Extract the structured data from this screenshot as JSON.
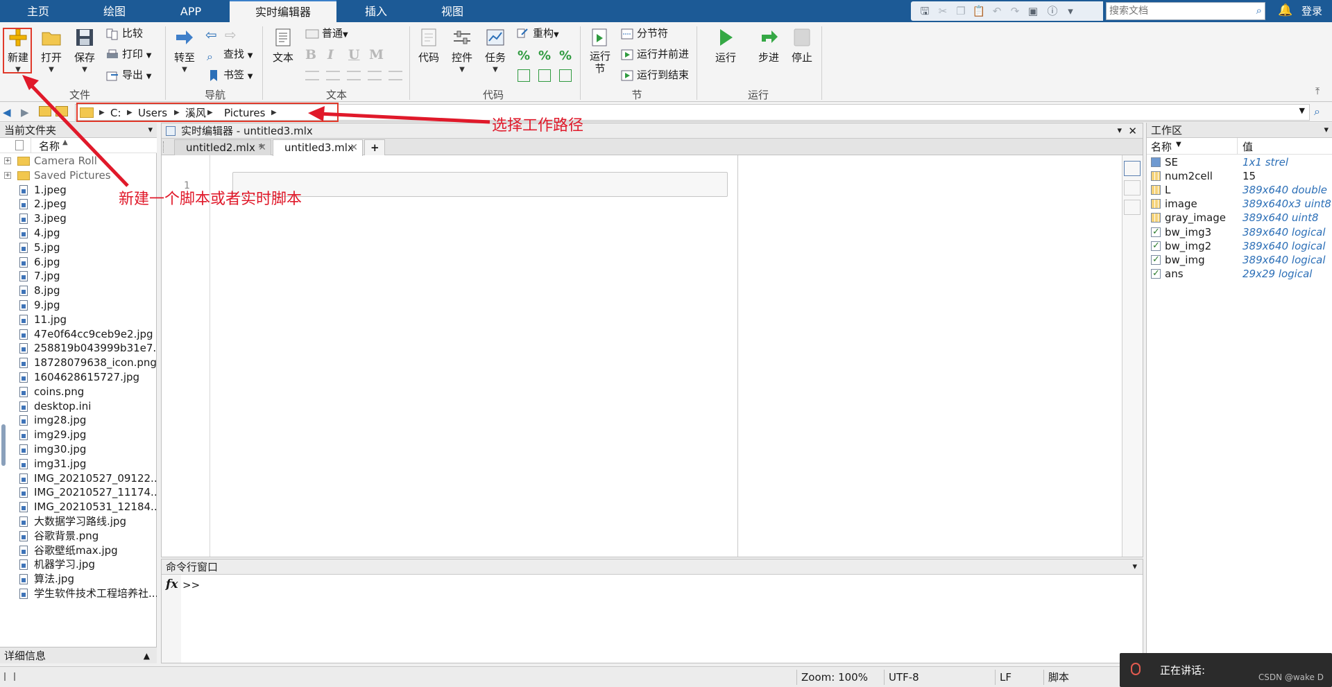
{
  "tabs": [
    "主页",
    "绘图",
    "APP",
    "实时编辑器",
    "插入",
    "视图"
  ],
  "active_tab": "实时编辑器",
  "search": {
    "placeholder": "搜索文档"
  },
  "login": "登录",
  "ribbon": {
    "file": {
      "new": "新建",
      "open": "打开",
      "save": "保存",
      "compare": "比较",
      "print": "打印",
      "export": "导出",
      "group": "文件"
    },
    "nav": {
      "goto": "转至",
      "find": "查找",
      "bookmark": "书签",
      "group": "导航"
    },
    "text": {
      "text": "文本",
      "style": "普通",
      "group": "文本",
      "bold": "B",
      "italic": "I",
      "underline": "U",
      "mono": "M"
    },
    "code": {
      "code": "代码",
      "control": "控件",
      "task": "任务",
      "refactor": "重构",
      "group": "代码"
    },
    "section": {
      "run_section": "运行\n节",
      "section_break": "分节符",
      "run_advance": "运行并前进",
      "run_to_end": "运行到结束",
      "group": "节"
    },
    "run": {
      "run": "运行",
      "step": "步进",
      "stop": "停止",
      "group": "运行"
    }
  },
  "path": [
    "C:",
    "Users",
    "溪风",
    "Pictures"
  ],
  "current_folder": {
    "title": "当前文件夹",
    "column": "名称",
    "items": [
      {
        "name": "Camera Roll",
        "type": "folder"
      },
      {
        "name": "Saved Pictures",
        "type": "folder"
      },
      {
        "name": "1.jpeg",
        "type": "file"
      },
      {
        "name": "2.jpeg",
        "type": "file"
      },
      {
        "name": "3.jpeg",
        "type": "file"
      },
      {
        "name": "4.jpg",
        "type": "file"
      },
      {
        "name": "5.jpg",
        "type": "file"
      },
      {
        "name": "6.jpg",
        "type": "file"
      },
      {
        "name": "7.jpg",
        "type": "file"
      },
      {
        "name": "8.jpg",
        "type": "file"
      },
      {
        "name": "9.jpg",
        "type": "file"
      },
      {
        "name": "11.jpg",
        "type": "file"
      },
      {
        "name": "47e0f64cc9ceb9e2.jpg",
        "type": "file"
      },
      {
        "name": "258819b043999b31e7...",
        "type": "file"
      },
      {
        "name": "18728079638_icon.png",
        "type": "file"
      },
      {
        "name": "1604628615727.jpg",
        "type": "file"
      },
      {
        "name": "coins.png",
        "type": "file"
      },
      {
        "name": "desktop.ini",
        "type": "file"
      },
      {
        "name": "img28.jpg",
        "type": "file"
      },
      {
        "name": "img29.jpg",
        "type": "file"
      },
      {
        "name": "img30.jpg",
        "type": "file"
      },
      {
        "name": "img31.jpg",
        "type": "file"
      },
      {
        "name": "IMG_20210527_09122...",
        "type": "file"
      },
      {
        "name": "IMG_20210527_11174...",
        "type": "file"
      },
      {
        "name": "IMG_20210531_12184...",
        "type": "file"
      },
      {
        "name": "大数据学习路线.jpg",
        "type": "file"
      },
      {
        "name": "谷歌背景.png",
        "type": "file"
      },
      {
        "name": "谷歌壁纸max.jpg",
        "type": "file"
      },
      {
        "name": "机器学习.jpg",
        "type": "file"
      },
      {
        "name": "算法.jpg",
        "type": "file"
      },
      {
        "name": "学生软件技术工程培养社...",
        "type": "file"
      }
    ],
    "details": "详细信息"
  },
  "editor": {
    "title": "实时编辑器 - untitled3.mlx",
    "tabs": [
      "untitled2.mlx *",
      "untitled3.mlx"
    ],
    "line_number": "1"
  },
  "command_window": {
    "title": "命令行窗口",
    "prompt": ">>",
    "fx": "fx"
  },
  "workspace": {
    "title": "工作区",
    "col_name": "名称",
    "col_value": "值",
    "vars": [
      {
        "name": "SE",
        "value": "1x1 strel",
        "icon": "obj"
      },
      {
        "name": "num2cell",
        "value": "15",
        "icon": "grid"
      },
      {
        "name": "L",
        "value": "389x640 double",
        "icon": "grid"
      },
      {
        "name": "image",
        "value": "389x640x3 uint8",
        "icon": "grid"
      },
      {
        "name": "gray_image",
        "value": "389x640 uint8",
        "icon": "grid"
      },
      {
        "name": "bw_img3",
        "value": "389x640 logical",
        "icon": "chk"
      },
      {
        "name": "bw_img2",
        "value": "389x640 logical",
        "icon": "chk"
      },
      {
        "name": "bw_img",
        "value": "389x640 logical",
        "icon": "chk"
      },
      {
        "name": "ans",
        "value": "29x29 logical",
        "icon": "chk"
      }
    ]
  },
  "status": {
    "zoom": "Zoom: 100%",
    "encoding": "UTF-8",
    "eol": "LF",
    "mode": "脚本"
  },
  "toast": {
    "text": "正在讲话:",
    "watermark": "CSDN @wake D"
  },
  "annotations": {
    "new_script": "新建一个脚本或者实时脚本",
    "select_path": "选择工作路径"
  },
  "colors": {
    "tabbar": "#1c5a96",
    "annotation": "#e0192a",
    "workspace_value": "#2c6fb7"
  }
}
